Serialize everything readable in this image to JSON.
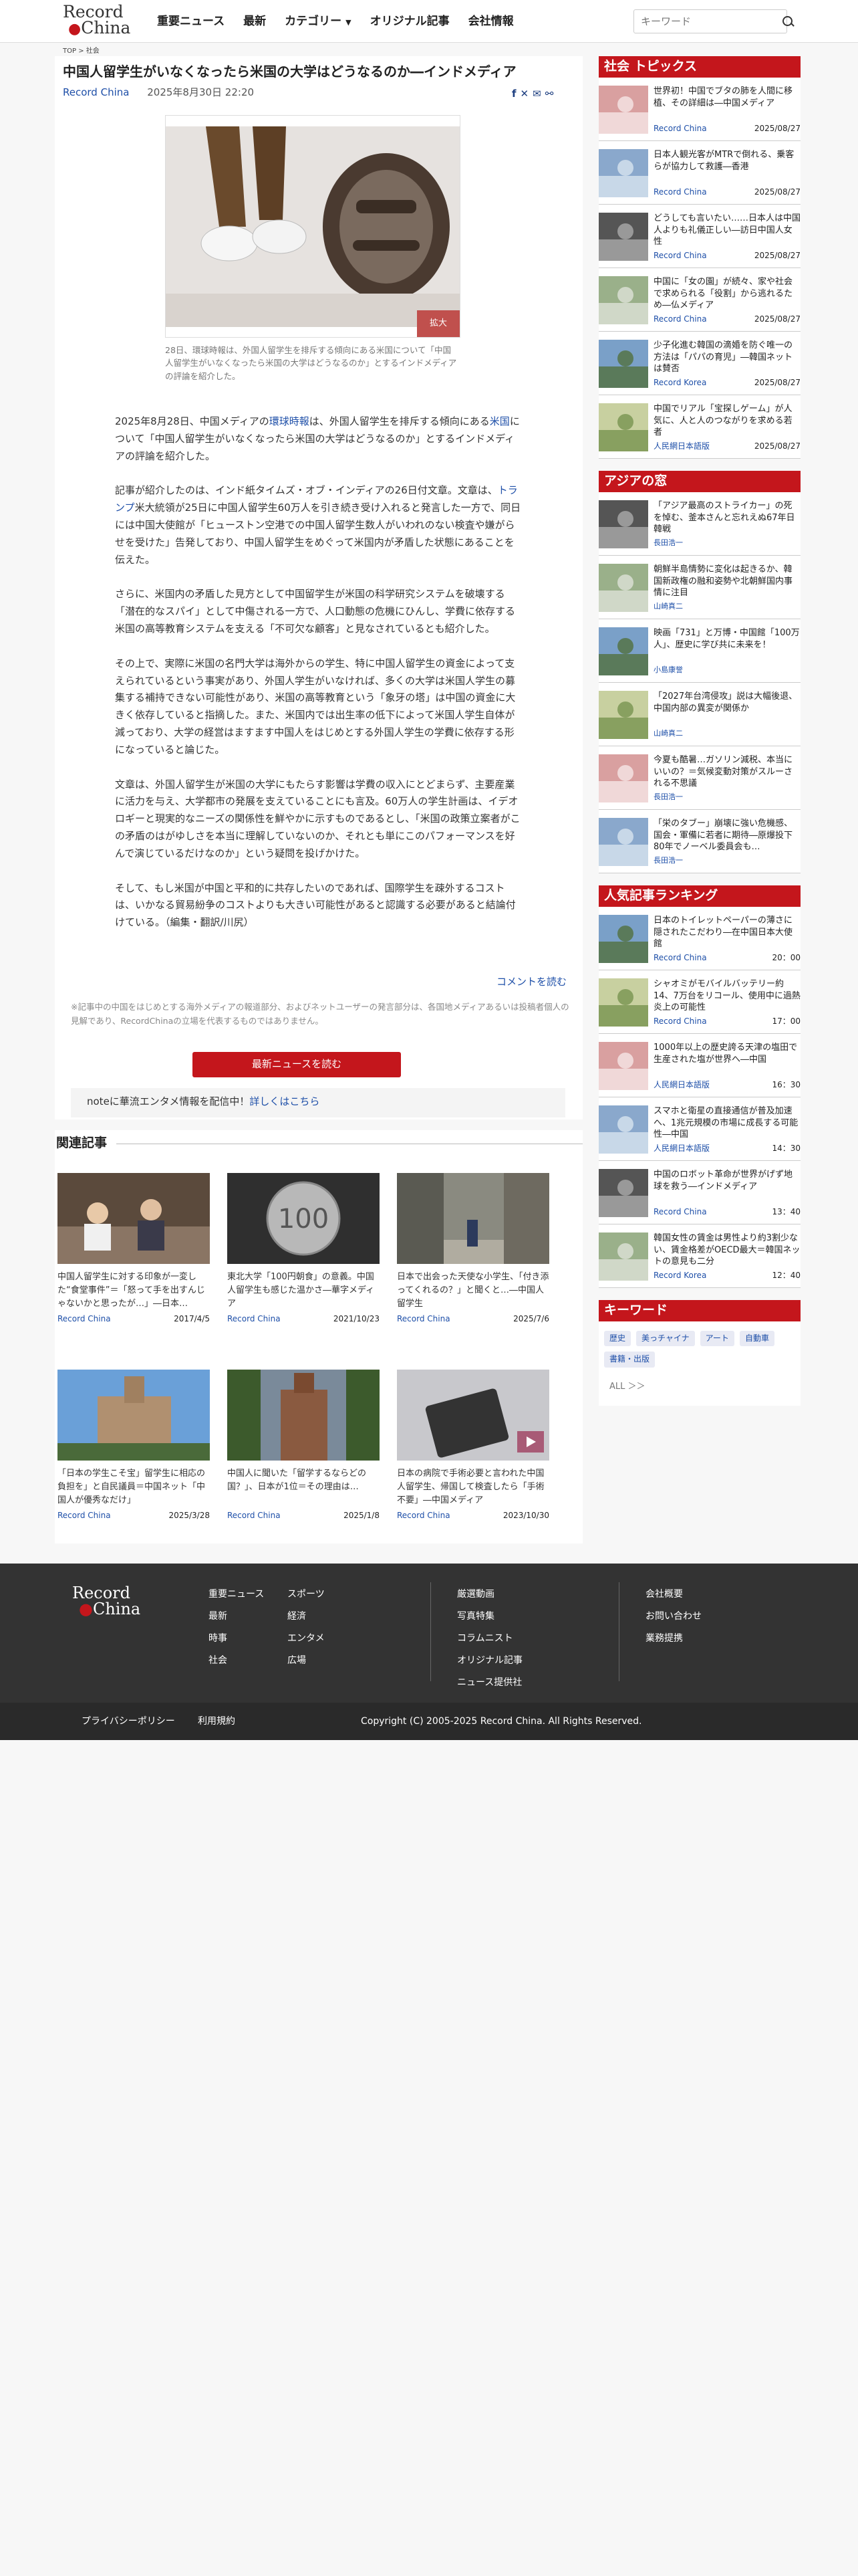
{
  "header": {
    "logo_line1": "Record",
    "logo_line2": "China",
    "nav": [
      "重要ニュース",
      "最新",
      "カテゴリー",
      "オリジナル記事",
      "会社情報"
    ],
    "chevron": "▼",
    "search_placeholder": "キーワード"
  },
  "breadcrumb": {
    "top": "TOP",
    "sep": ">",
    "current": "社会"
  },
  "article": {
    "title": "中国人留学生がいなくなったら米国の大学はどうなるのか―インドメディア",
    "source": "Record China",
    "datetime": "2025年8月30日 22:20",
    "zoom_label": "拡大",
    "caption": "28日、環球時報は、外国人留学生を排斥する傾向にある米国について「中国人留学生がいなくなったら米国の大学はどうなるのか」とするインドメディアの評論を紹介した。",
    "p1_a": "2025年8月28日、中国メディアの",
    "p1_link1": "環球時報",
    "p1_b": "は、外国人留学生を排斥する傾向にある",
    "p1_link2": "米国",
    "p1_c": "について「中国人留学生がいなくなったら米国の大学はどうなるのか」とするインドメディアの評論を紹介した。",
    "p2_a": "記事が紹介したのは、インド紙タイムズ・オブ・インディアの26日付文章。文章は、",
    "p2_link": "トランプ",
    "p2_b": "米大統領が25日に中国人留学生60万人を引き続き受け入れると発言した一方で、同日には中国大使館が「ヒューストン空港での中国人留学生数人がいわれのない検査や嫌がらせを受けた」告発しており、中国人留学生をめぐって米国内が矛盾した状態にあることを伝えた。",
    "p3": "さらに、米国内の矛盾した見方として中国留学生が米国の科学研究システムを破壊する「潜在的なスパイ」として中傷される一方で、人口動態の危機にひんし、学費に依存する米国の高等教育システムを支える「不可欠な顧客」と見なされているとも紹介した。",
    "p4": "その上で、実際に米国の名門大学は海外からの学生、特に中国人留学生の資金によって支えられているという事実があり、外国人学生がいなければ、多くの大学は米国人学生の募集する補持できない可能性があり、米国の高等教育という「象牙の塔」は中国の資金に大きく依存していると指摘した。また、米国内では出生率の低下によって米国人学生自体が減っており、大学の経営はますます中国人をはじめとする外国人学生の学費に依存する形になっていると論じた。",
    "p5": "文章は、外国人留学生が米国の大学にもたらす影響は学費の収入にとどまらず、主要産業に活力を与え、大学都市の発展を支えていることにも言及。60万人の学生計画は、イデオロギーと現実的なニーズの関係性を鮮やかに示すものであるとし、「米国の政策立案者がこの矛盾のはがゆしさを本当に理解していないのか、それとも単にこのパフォーマンスを好んで演じているだけなのか」という疑問を投げかけた。",
    "p6": "そして、もし米国が中国と平和的に共存したいのであれば、国際学生を疎外するコストは、いかなる貿易紛争のコストよりも大きい可能性があると認識する必要があると結論付けている。（編集・翻訳/川尻）",
    "comment_link": "コメントを読む",
    "notice": "※記事中の中国をはじめとする海外メディアの報道部分、およびネットユーザーの発言部分は、各国地メディアあるいは投稿者個人の見解であり、RecordChinaの立場を代表するものではありません。",
    "latest_button": "最新ニュースを読む",
    "note_text": "noteに華流エンタメ情報を配信中！",
    "note_link": "詳しくはこちら"
  },
  "related": {
    "heading": "関連記事",
    "items": [
      {
        "title": "中国人留学生に対する印象が一変した“食堂事件”＝「怒って手を出すんじゃないかと思ったが…」―日本…",
        "source": "Record China",
        "date": "2017/4/5"
      },
      {
        "title": "東北大学「100円朝食」の意義。中国人留学生も感じた温かさ―華字メディア",
        "source": "Record China",
        "date": "2021/10/23",
        "coin": "100"
      },
      {
        "title": "日本で出会った天使な小学生、「付き添ってくれるの？」と聞くと…―中国人留学生",
        "source": "Record China",
        "date": "2025/7/6"
      },
      {
        "title": "「日本の学生こそ宝」留学生に相応の負担を」と自民議員＝中国ネット「中国人が優秀なだけ」",
        "source": "Record China",
        "date": "2025/3/28"
      },
      {
        "title": "中国人に聞いた「留学するならどの国？」、日本が1位＝その理由は…",
        "source": "Record China",
        "date": "2025/1/8"
      },
      {
        "title": "日本の病院で手術必要と言われた中国人留学生、帰国して検査したら「手術不要」―中国メディア",
        "source": "Record China",
        "date": "2023/10/30"
      }
    ]
  },
  "sidebar": {
    "social": {
      "heading": "社会 トピックス",
      "items": [
        {
          "title": "世界初！中国でブタの肺を人間に移植、その詳細は―中国メディア",
          "source": "Record China",
          "date": "2025/08/27"
        },
        {
          "title": "日本人観光客がMTRで倒れる、乗客らが協力して救護―香港",
          "source": "Record China",
          "date": "2025/08/27"
        },
        {
          "title": "どうしても言いたい……日本人は中国人よりも礼儀正しい―訪日中国人女性",
          "source": "Record China",
          "date": "2025/08/27"
        },
        {
          "title": "中国に「女の園」が続々、家や社会で求められる「役割」から逃れるため―仏メディア",
          "source": "Record China",
          "date": "2025/08/27"
        },
        {
          "title": "少子化進む韓国の滴婚を防ぐ唯一の方法は「パパの育児」―韓国ネットは賛否",
          "source": "Record Korea",
          "date": "2025/08/27"
        },
        {
          "title": "中国でリアル「宝探しゲーム」が人気に、人と人のつながりを求める若者",
          "source": "人民網日本語版",
          "date": "2025/08/27"
        }
      ]
    },
    "asia": {
      "heading": "アジアの窓",
      "items": [
        {
          "title": "「アジア最高のストライカー」の死を悼む、釜本さんと忘れえぬ67年日韓戦",
          "author": "長田浩一"
        },
        {
          "title": "朝鮮半島情勢に変化は起きるか、韓国新政権の融和姿勢や北朝鮮国内事情に注目",
          "author": "山崎真二"
        },
        {
          "title": "映画「731」と万博・中国館「100万人」、歴史に学び共に未来を！",
          "author": "小島康誉"
        },
        {
          "title": "「2027年台湾侵攻」説は大幅後退、中国内部の異変が関係か",
          "author": "山崎真二"
        },
        {
          "title": "今夏も酷暑…ガソリン減税、本当にいいの？＝気候変動対策がスルーされる不思議",
          "author": "長田浩一"
        },
        {
          "title": "「栄のタブー」崩壊に強い危機感、国会・軍備に若者に期待―原爆投下80年でノーベル委員会も…",
          "author": "長田浩一"
        }
      ]
    },
    "ranking": {
      "heading": "人気記事ランキング",
      "items": [
        {
          "title": "日本のトイレットペーパーの薄さに隠されたこだわり―在中国日本大使館",
          "source": "Record China",
          "time": "20：00"
        },
        {
          "title": "シャオミがモバイルバッテリー約14、7万台をリコール、使用中に過熱炎上の可能性",
          "source": "Record China",
          "time": "17：00"
        },
        {
          "title": "1000年以上の歴史誇る天津の塩田で生産された塩が世界へ―中国",
          "source": "人民網日本語版",
          "time": "16：30"
        },
        {
          "title": "スマホと衛星の直接通信が普及加速へ、1兆元規模の市場に成長する可能性―中国",
          "source": "人民網日本語版",
          "time": "14：30"
        },
        {
          "title": "中国のロボット革命が世界がげず地球を救う―インドメディア",
          "source": "Record China",
          "time": "13：40"
        },
        {
          "title": "韓国女性の賃金は男性より約3割少ない、賃金格差がOECD最大＝韓国ネットの意見も二分",
          "source": "Record Korea",
          "time": "12：40"
        }
      ]
    },
    "keywords": {
      "heading": "キーワード",
      "tags": [
        "歴史",
        "美っチャイナ",
        "アート",
        "自動車",
        "書籍・出版"
      ],
      "all": "ALL ＞＞"
    }
  },
  "footer": {
    "logo_line1": "Record",
    "logo_line2": "China",
    "col1": [
      "重要ニュース",
      "最新",
      "時事",
      "社会"
    ],
    "col2": [
      "スポーツ",
      "経済",
      "エンタメ",
      "広場"
    ],
    "col3": [
      "厳選動画",
      "写真特集",
      "コラムニスト",
      "オリジナル記事",
      "ニュース提供社"
    ],
    "col4": [
      "会社概要",
      "お問い合わせ",
      "業務提携"
    ],
    "privacy": "プライバシーポリシー",
    "terms": "利用規約",
    "copyright": "Copyright (C) 2005-2025 Record China. All Rights Reserved."
  },
  "colors": {
    "accent": "#c4161c",
    "link": "#1e4fa8"
  }
}
